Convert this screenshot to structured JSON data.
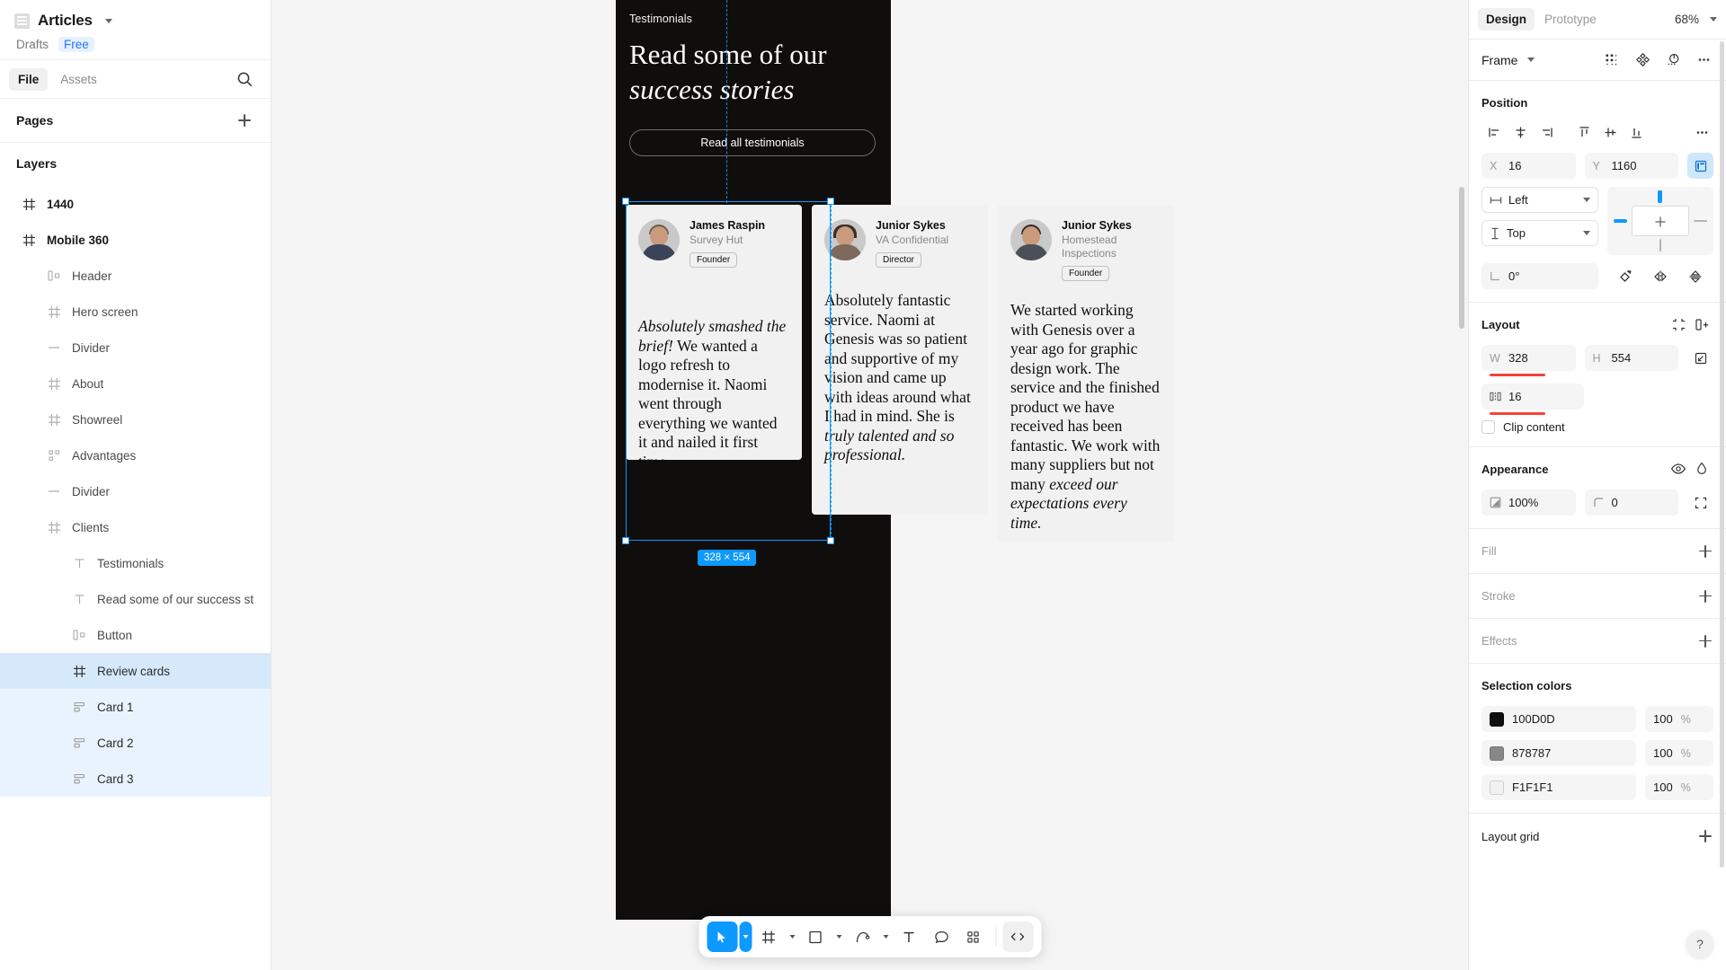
{
  "left_panel": {
    "file_title": "Articles",
    "file_icon": "document-icon",
    "breadcrumb_drafts": "Drafts",
    "breadcrumb_plan": "Free",
    "tabs": [
      {
        "label": "File",
        "active": true
      },
      {
        "label": "Assets",
        "active": false
      }
    ],
    "search_icon": "search-icon",
    "pages_title": "Pages",
    "layers_title": "Layers",
    "layers": [
      {
        "label": "1440",
        "icon": "frame-icon",
        "depth": 0,
        "state": "none"
      },
      {
        "label": "Mobile 360",
        "icon": "frame-icon",
        "depth": 0,
        "state": "none"
      },
      {
        "label": "Header",
        "icon": "component-icon",
        "depth": 1,
        "state": "none"
      },
      {
        "label": "Hero screen",
        "icon": "frame-icon",
        "depth": 1,
        "state": "none"
      },
      {
        "label": "Divider",
        "icon": "line-icon",
        "depth": 1,
        "state": "none"
      },
      {
        "label": "About",
        "icon": "frame-icon",
        "depth": 1,
        "state": "none"
      },
      {
        "label": "Showreel",
        "icon": "frame-icon",
        "depth": 1,
        "state": "none"
      },
      {
        "label": "Advantages",
        "icon": "group-icon",
        "depth": 1,
        "state": "none"
      },
      {
        "label": "Divider",
        "icon": "line-icon",
        "depth": 1,
        "state": "none"
      },
      {
        "label": "Clients",
        "icon": "frame-icon",
        "depth": 1,
        "state": "none"
      },
      {
        "label": "Testimonials",
        "icon": "text-icon",
        "depth": 2,
        "state": "none"
      },
      {
        "label": "Read some of our success st",
        "icon": "text-icon",
        "depth": 2,
        "state": "none"
      },
      {
        "label": "Button",
        "icon": "component-icon",
        "depth": 2,
        "state": "none"
      },
      {
        "label": "Review cards",
        "icon": "frame-icon",
        "depth": 2,
        "state": "selected"
      },
      {
        "label": "Card 1",
        "icon": "autolayout-icon",
        "depth": 3,
        "state": "child-selected"
      },
      {
        "label": "Card 2",
        "icon": "autolayout-icon",
        "depth": 3,
        "state": "child-selected"
      },
      {
        "label": "Card 3",
        "icon": "autolayout-icon",
        "depth": 3,
        "state": "child-selected"
      }
    ]
  },
  "canvas": {
    "frame_background": "#100D0D",
    "kicker": "Testimonials",
    "headline_line1": "Read some of our",
    "headline_line2": "success stories",
    "cta_label": "Read all testimonials",
    "selection_size_chip": "328 × 554",
    "selection_color": "#0D99FF",
    "cards": [
      {
        "name": "James Raspin",
        "org": "Survey Hut",
        "badge": "Founder",
        "quote_italic": "Absolutely smashed the brief!",
        "quote_rest": " We wanted a logo refresh to modernise it. Naomi went through everything we wanted it and nailed it first time."
      },
      {
        "name": "Junior Sykes",
        "org": "VA Confidential",
        "badge": "Director",
        "quote_lead": "Absolutely fantastic service. Naomi at Genesis was so patient and supportive of my vision and came up with ideas around what I had in mind. She is ",
        "quote_italic": "truly talented and so professional."
      },
      {
        "name": "Junior Sykes",
        "org": "Homestead Inspections",
        "badge": "Founder",
        "quote_lead": "We started working with Genesis over a year ago for graphic design work. The service and the finished product we have received has been fantastic. We work with many suppliers but not many ",
        "quote_italic": "exceed our expectations every time."
      }
    ]
  },
  "toolbar": {
    "items": [
      {
        "name": "move-tool",
        "icon": "cursor-icon",
        "active": true,
        "has_caret": true
      },
      {
        "name": "frame-tool",
        "icon": "frame-icon",
        "active": false,
        "has_caret": true
      },
      {
        "name": "shape-tool",
        "icon": "square-icon",
        "active": false,
        "has_caret": true
      },
      {
        "name": "pen-tool",
        "icon": "pen-icon",
        "active": false,
        "has_caret": true
      },
      {
        "name": "text-tool",
        "icon": "text-icon",
        "active": false,
        "has_caret": false
      },
      {
        "name": "comment-tool",
        "icon": "comment-icon",
        "active": false,
        "has_caret": false
      },
      {
        "name": "actions-tool",
        "icon": "grid-plus-icon",
        "active": false,
        "has_caret": false
      },
      {
        "name": "dev-mode-tool",
        "icon": "code-icon",
        "active": false,
        "has_caret": false
      }
    ]
  },
  "right_panel": {
    "tabs": [
      {
        "label": "Design",
        "active": true
      },
      {
        "label": "Prototype",
        "active": false
      }
    ],
    "zoom_level": "68%",
    "node_type": "Frame",
    "header_icons": [
      "grid-icon",
      "component-icon",
      "annotation-icon",
      "more-icon"
    ],
    "position": {
      "title": "Position",
      "align_icons": [
        "align-left-icon",
        "align-horizontal-center-icon",
        "align-right-icon",
        "align-top-icon",
        "align-vertical-center-icon",
        "align-bottom-icon",
        "more-icon"
      ],
      "x_label": "X",
      "x_value": "16",
      "y_label": "Y",
      "y_value": "1160",
      "constrain_button": "position-constraint-icon",
      "horizontal_constraint": "Left",
      "vertical_constraint": "Top",
      "rotation_label": "angle-icon",
      "rotation_value": "0°",
      "flip_icons": [
        "rotate-icon",
        "flip-horizontal-icon",
        "flip-vertical-icon"
      ]
    },
    "layout": {
      "title": "Layout",
      "icons": [
        "resize-to-fit-icon",
        "add-autolayout-icon"
      ],
      "w_label": "W",
      "w_value": "328",
      "h_label": "H",
      "h_value": "554",
      "gap_label": "gap-icon",
      "gap_value": "16",
      "constrain_proportions_icon": "constrain-proportions-icon",
      "clip_content_label": "Clip content",
      "clip_content_checked": false,
      "highlight_color": "#F2443A"
    },
    "appearance": {
      "title": "Appearance",
      "icons": [
        "visibility-icon",
        "blend-mode-icon"
      ],
      "opacity_icon": "opacity-icon",
      "opacity_value": "100%",
      "corner_icon": "corner-radius-icon",
      "corner_value": "0",
      "independent_corners_icon": "independent-corners-icon"
    },
    "fill": {
      "title": "Fill",
      "add_icon": "plus-icon"
    },
    "stroke": {
      "title": "Stroke",
      "add_icon": "plus-icon"
    },
    "effects": {
      "title": "Effects",
      "add_icon": "plus-icon"
    },
    "selection_colors": {
      "title": "Selection colors",
      "items": [
        {
          "hex": "100D0D",
          "swatch": "#100D0D",
          "opacity": "100",
          "unit": "%"
        },
        {
          "hex": "878787",
          "swatch": "#878787",
          "opacity": "100",
          "unit": "%"
        },
        {
          "hex": "F1F1F1",
          "swatch": "#F1F1F1",
          "opacity": "100",
          "unit": "%"
        }
      ]
    },
    "layout_grid": {
      "title": "Layout grid",
      "add_icon": "plus-icon"
    },
    "help_button": "?"
  }
}
